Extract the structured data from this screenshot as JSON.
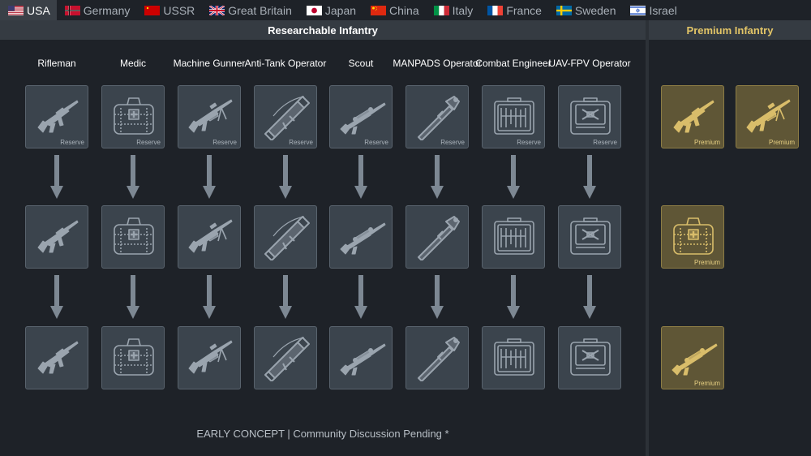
{
  "nations": [
    {
      "name": "USA",
      "flag": "us-flag",
      "active": true
    },
    {
      "name": "Germany",
      "flag": "germany-flag",
      "active": false
    },
    {
      "name": "USSR",
      "flag": "ussr-flag",
      "active": false
    },
    {
      "name": "Great Britain",
      "flag": "uk-flag",
      "active": false
    },
    {
      "name": "Japan",
      "flag": "japan-flag",
      "active": false
    },
    {
      "name": "China",
      "flag": "china-flag",
      "active": false
    },
    {
      "name": "Italy",
      "flag": "italy-flag",
      "active": false
    },
    {
      "name": "France",
      "flag": "france-flag",
      "active": false
    },
    {
      "name": "Sweden",
      "flag": "sweden-flag",
      "active": false
    },
    {
      "name": "Israel",
      "flag": "israel-flag",
      "active": false
    }
  ],
  "research": {
    "title": "Researchable Infantry",
    "columns": [
      {
        "label": "Rifleman",
        "icon": "rifle-icon"
      },
      {
        "label": "Medic",
        "icon": "medkit-icon"
      },
      {
        "label": "Machine Gunner",
        "icon": "machine-gun-icon"
      },
      {
        "label": "Anti-Tank Operator",
        "icon": "launcher-icon"
      },
      {
        "label": "Scout",
        "icon": "sniper-rifle-icon"
      },
      {
        "label": "MANPADS Operator",
        "icon": "manpads-icon"
      },
      {
        "label": "Combat Engineer",
        "icon": "tool-case-icon"
      },
      {
        "label": "UAV-FPV Operator",
        "icon": "drone-case-icon"
      }
    ],
    "tiers": 3,
    "reserve_label": "Reserve"
  },
  "premium": {
    "title": "Premium Infantry",
    "label": "Premium",
    "items": [
      {
        "icon": "rifle-icon"
      },
      {
        "icon": "machine-gun-icon"
      },
      {
        "icon": "medkit-icon"
      },
      {
        "icon": "sniper-rifle-icon"
      }
    ]
  },
  "colors": {
    "premium_accent": "#e3c567",
    "icon_grey": "#9aa4ae",
    "icon_gold": "#d9bd6a"
  },
  "footer": "EARLY CONCEPT | Community Discussion Pending *"
}
